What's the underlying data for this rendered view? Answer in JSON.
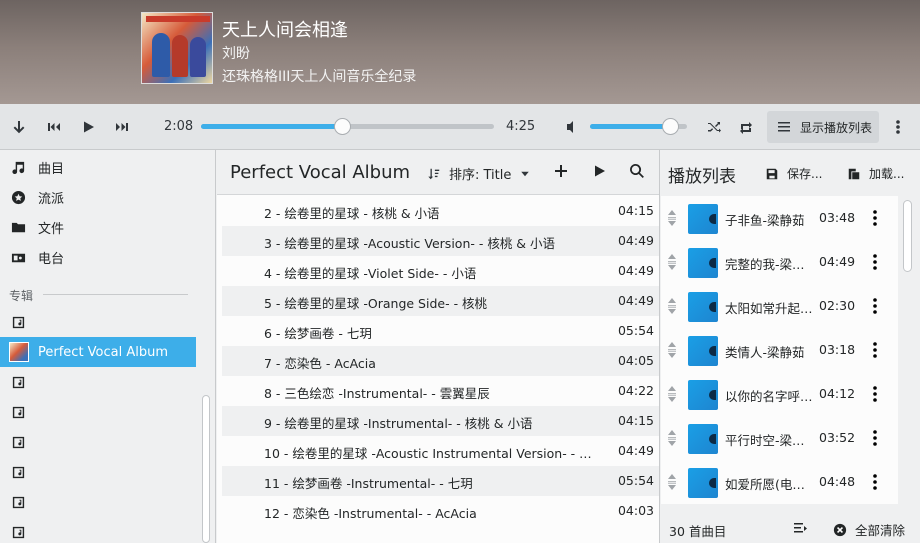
{
  "now_playing": {
    "title": "天上人间会相逢",
    "artist": "刘盼",
    "album": "还珠格格III天上人间音乐全纪录"
  },
  "transport": {
    "elapsed": "2:08",
    "total": "4:25",
    "progress_fraction": 0.48,
    "volume_fraction": 0.82,
    "show_playlist_label": "显示播放列表"
  },
  "sidebar": {
    "items": [
      {
        "label": "曲目",
        "icon": "music-note-icon"
      },
      {
        "label": "流派",
        "icon": "genre-icon"
      },
      {
        "label": "文件",
        "icon": "folder-icon"
      },
      {
        "label": "电台",
        "icon": "radio-icon"
      }
    ],
    "section_label": "专辑",
    "selected_album": "Perfect Vocal Album"
  },
  "tracklist": {
    "title": "Perfect Vocal Album",
    "sort_label": "排序: Title",
    "tracks": [
      {
        "name": "2 - 绘卷里的星球 - 核桃 & 小语",
        "duration": "04:15"
      },
      {
        "name": "3 - 绘卷里的星球 -Acoustic Version- - 核桃 & 小语",
        "duration": "04:49"
      },
      {
        "name": "4 - 绘卷里的星球 -Violet Side- - 小语",
        "duration": "04:49"
      },
      {
        "name": "5 - 绘卷里的星球 -Orange Side- - 核桃",
        "duration": "04:49"
      },
      {
        "name": "6 - 绘梦画卷 - 七玥",
        "duration": "05:54"
      },
      {
        "name": "7 - 恋染色 - AcAcia",
        "duration": "04:05"
      },
      {
        "name": "8 - 三色绘恋 -Instrumental- - 雲翼星辰",
        "duration": "04:22"
      },
      {
        "name": "9 - 绘卷里的星球 -Instrumental- - 核桃 & 小语",
        "duration": "04:15"
      },
      {
        "name": "10 - 绘卷里的星球 -Acoustic Instrumental Version- - 核桃 & 小语",
        "duration": "04:49"
      },
      {
        "name": "11 - 绘梦画卷 -Instrumental- - 七玥",
        "duration": "05:54"
      },
      {
        "name": "12 - 恋染色 -Instrumental- - AcAcia",
        "duration": "04:03"
      }
    ]
  },
  "playlist": {
    "title": "播放列表",
    "save_label": "保存...",
    "load_label": "加载...",
    "items": [
      {
        "name": "子非鱼-梁静茹",
        "duration": "03:48"
      },
      {
        "name": "完整的我-梁静茹",
        "duration": "04:49"
      },
      {
        "name": "太阳如常升起-梁静茹",
        "duration": "02:30"
      },
      {
        "name": "类情人-梁静茹",
        "duration": "03:18"
      },
      {
        "name": "以你的名字呼唤我-梁静茹",
        "duration": "04:12"
      },
      {
        "name": "平行时空-梁静茹",
        "duration": "03:52"
      },
      {
        "name": "如爱所愿(电影版)-梁静茹",
        "duration": "04:48"
      }
    ],
    "count_label": "30 首曲目",
    "clear_label": "全部清除"
  },
  "colors": {
    "accent": "#3daee9",
    "background": "#eff0f1",
    "text": "#232627"
  }
}
